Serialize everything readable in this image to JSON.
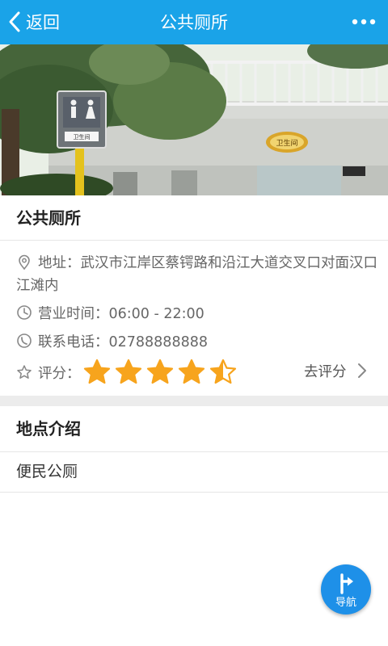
{
  "header": {
    "back_label": "返回",
    "title": "公共厕所",
    "more_icon": "more-dots-icon",
    "bg_color": "#1aa3e8"
  },
  "photo": {
    "sign_text": "卫生间",
    "plaque_text": "卫生间"
  },
  "place": {
    "name": "公共厕所",
    "address_label": "地址：",
    "address": "武汉市江岸区蔡锷路和沿江大道交叉口对面汉口江滩内",
    "hours_label": "营业时间：",
    "hours": "06:00 - 22:00",
    "phone_label": "联系电话：",
    "phone": "02788888888",
    "rating_label": "评分：",
    "rating": 4.5,
    "rating_max": 5,
    "rate_action": "去评分",
    "star_color": "#f7a41d"
  },
  "intro": {
    "title": "地点介绍",
    "content": "便民公厕"
  },
  "fab": {
    "label": "导航",
    "icon": "navigation-turn-icon",
    "color": "#1e90e8"
  }
}
